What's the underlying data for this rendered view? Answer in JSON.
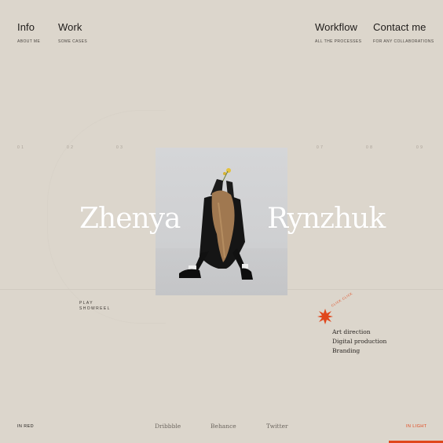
{
  "nav": {
    "info": {
      "title": "Info",
      "sub": "ABOUT ME"
    },
    "work": {
      "title": "Work",
      "sub": "SOME CASES"
    },
    "workflow": {
      "title": "Workflow",
      "sub": "ALL THE PROCESSES"
    },
    "contact": {
      "title": "Contact me",
      "sub": "FOR ANY COLLABORATIONS"
    }
  },
  "ruler": [
    "0 1",
    "0 2",
    "0 3",
    "0 7",
    "0 8",
    "0 9"
  ],
  "hero": {
    "first_name": "Zhenya",
    "last_name": "Rynzhuk"
  },
  "showreel": {
    "line1": "PLAY",
    "line2": "SHOWREEL"
  },
  "badge": {
    "text": "CLICK CLICK",
    "color": "#e0471c"
  },
  "services": [
    "Art direction",
    "Digital production",
    "Branding"
  ],
  "footer": {
    "left": "IN RED",
    "right": "IN LIGHT",
    "social": [
      "Dribbble",
      "Behance",
      "Twitter"
    ]
  },
  "colors": {
    "background": "#dcd6cc",
    "accent": "#e0471c"
  }
}
